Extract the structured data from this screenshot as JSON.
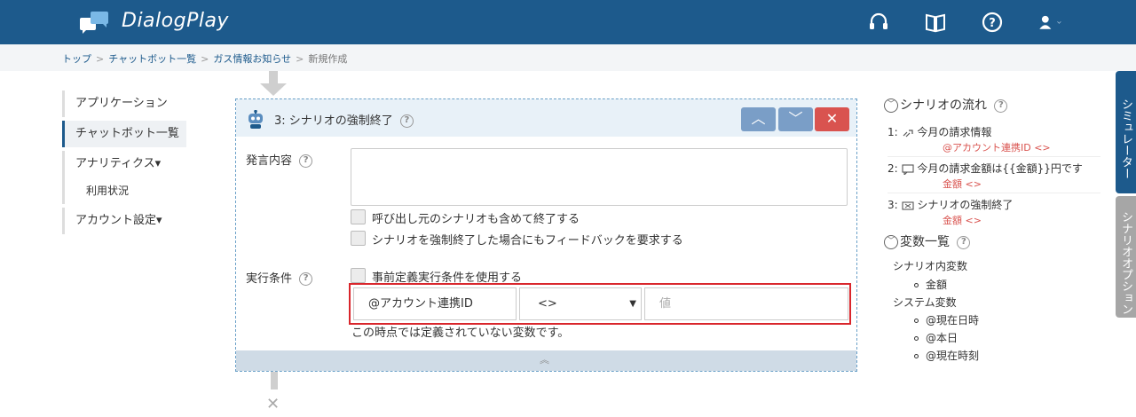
{
  "app": {
    "brand": "DialogPlay"
  },
  "breadcrumb": [
    "トップ",
    "チャットボット一覧",
    "ガス情報お知らせ",
    "新規作成"
  ],
  "breadcrumb_sep": ">",
  "nav": {
    "applications": "アプリケーション",
    "chatbots": "チャットボット一覧",
    "analytics": "アナリティクス▾",
    "usage": "利用状況",
    "account": "アカウント設定▾"
  },
  "card": {
    "title": "3: シナリオの強制終了",
    "up": "︿",
    "down": "﹀",
    "delete": "✕",
    "speech_label": "発言内容",
    "opt1": "呼び出し元のシナリオも含めて終了する",
    "opt2": "シナリオを強制終了した場合にもフィードバックを要求する",
    "cond_label": "実行条件",
    "opt3": "事前定義実行条件を使用する",
    "condition": {
      "variable": "@アカウント連携ID",
      "operator": "<>",
      "value_placeholder": "値"
    },
    "hint": "この時点では定義されていない変数です。",
    "collapse": "︽"
  },
  "right": {
    "flow_title": "シナリオの流れ",
    "flow": [
      {
        "num": "1:",
        "icon": "link-icon",
        "text": "今月の請求情報",
        "cond": "@アカウント連携ID <>"
      },
      {
        "num": "2:",
        "icon": "speech-bubble-icon",
        "text": "今月の請求金額は{{金額}}円です",
        "cond": "金額 <>"
      },
      {
        "num": "3:",
        "icon": "exit-icon",
        "text": "シナリオの強制終了",
        "cond": "金額 <>"
      }
    ],
    "vars_title": "変数一覧",
    "scenario_vars_label": "シナリオ内変数",
    "scenario_vars": [
      "金額"
    ],
    "system_vars_label": "システム変数",
    "system_vars": [
      "@現在日時",
      "@本日",
      "@現在時刻"
    ]
  },
  "side_tabs": {
    "simulator": "シミュレーター",
    "options": "シナリオオプション"
  },
  "colors": {
    "header": "#1d5a8c",
    "accent": "#1d5a8c",
    "danger": "#d9534f",
    "highlight": "#d9262c"
  }
}
